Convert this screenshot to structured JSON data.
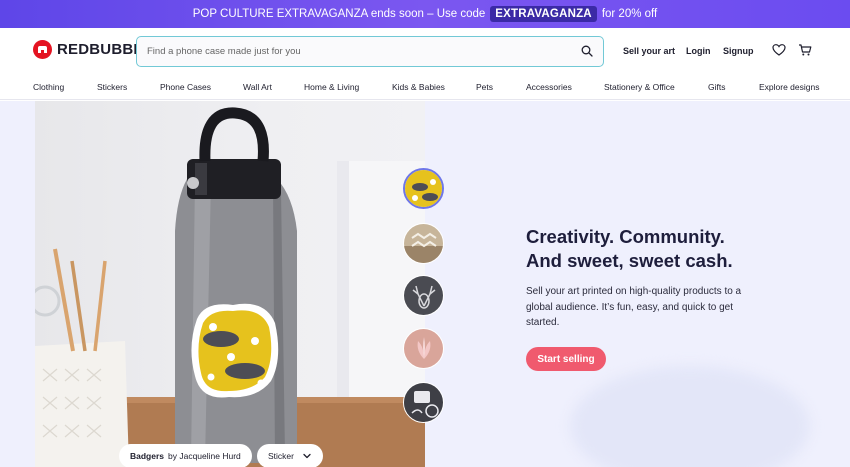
{
  "promo": {
    "text_before": "POP CULTURE EXTRAVAGANZA ends soon – Use code",
    "code": "EXTRAVAGANZA",
    "text_after": "for 20% off"
  },
  "header": {
    "logo_text": "REDBUBBLE",
    "search_placeholder": "Find a phone case made just for you",
    "sell_label": "Sell your art",
    "login_label": "Login",
    "signup_label": "Signup",
    "icons": [
      "search-icon",
      "heart-icon",
      "cart-icon"
    ]
  },
  "categories": [
    "Clothing",
    "Stickers",
    "Phone Cases",
    "Wall Art",
    "Home & Living",
    "Kids & Babies",
    "Pets",
    "Accessories",
    "Stationery & Office",
    "Gifts",
    "Explore designs"
  ],
  "hero": {
    "headline_line1": "Creativity. Community.",
    "headline_line2": "And sweet, sweet cash.",
    "subtext": "Sell your art printed on high-quality products to a global audience. It’s fun, easy, and quick to get started.",
    "cta_label": "Start selling",
    "design_title": "Badgers",
    "design_by": "by Jacqueline Hurd",
    "product_label": "Sticker"
  },
  "colors": {
    "promo_bg": "#6b4cf0",
    "brand_red": "#e41321",
    "cta": "#f05a6e",
    "hero_bg": "#eff0fd",
    "thumb_active": "#6e76e8"
  }
}
